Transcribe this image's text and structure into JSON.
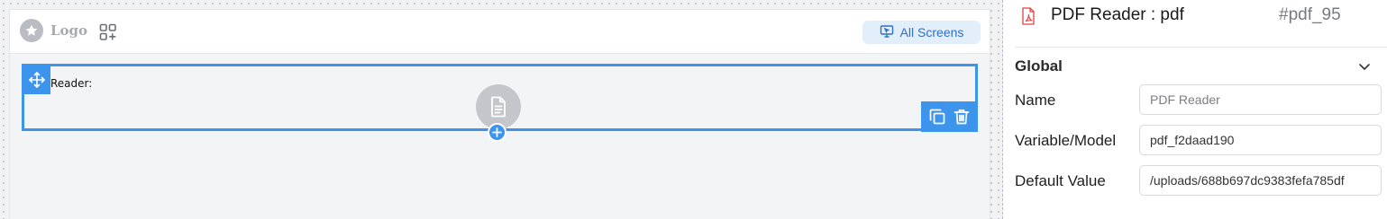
{
  "canvas": {
    "logo_text": "Logo",
    "all_screens_label": "All Screens",
    "component": {
      "label": "Reader:"
    }
  },
  "panel": {
    "title": "PDF Reader : pdf",
    "component_id": "#pdf_95",
    "section_title": "Global",
    "fields": {
      "name": {
        "label": "Name",
        "placeholder": "PDF Reader",
        "value": ""
      },
      "variable": {
        "label": "Variable/Model",
        "value": "pdf_f2daad190"
      },
      "default_value": {
        "label": "Default Value",
        "value": "/uploads/688b697dc9383fefa785df"
      }
    }
  },
  "icons": {
    "logo": "star-icon",
    "apps": "apps-add-icon",
    "all_screens": "screen-cursor-icon",
    "move": "move-arrows-icon",
    "document": "document-icon",
    "duplicate": "copy-icon",
    "delete": "trash-icon",
    "add": "plus-icon",
    "pdf": "pdf-file-icon",
    "collapse": "chevron-down-icon"
  },
  "colors": {
    "accent": "#3c94ec",
    "pill_bg": "#e3eefb",
    "pill_text": "#2f6fc6"
  }
}
